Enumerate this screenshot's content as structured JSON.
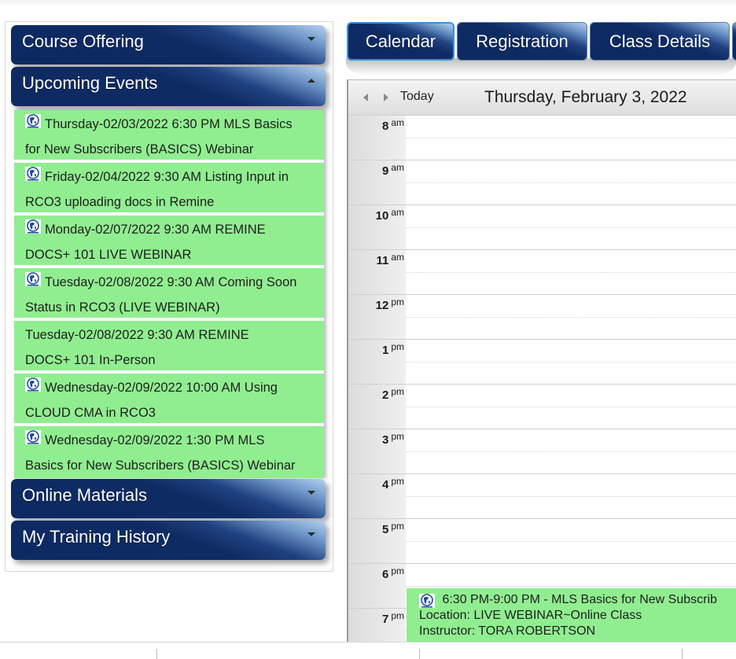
{
  "sidebar": {
    "sections": [
      {
        "label": "Course Offering",
        "state": "collapsed",
        "icon": "chevron-down-icon"
      },
      {
        "label": "Upcoming Events",
        "state": "expanded",
        "icon": "chevron-up-icon"
      },
      {
        "label": "Online Materials",
        "state": "collapsed",
        "icon": "chevron-down-icon"
      },
      {
        "label": "My Training History",
        "state": "collapsed",
        "icon": "chevron-down-icon"
      }
    ],
    "events": [
      {
        "line1": "Thursday-02/03/2022 6:30 PM MLS Basics",
        "line2": "for New Subscribers (BASICS) Webinar",
        "icon": "globe-icon"
      },
      {
        "line1": "Friday-02/04/2022 9:30 AM Listing Input in",
        "line2": "RCO3 uploading docs in Remine",
        "icon": "globe-icon"
      },
      {
        "line1": "Monday-02/07/2022 9:30 AM REMINE",
        "line2": "DOCS+ 101 LIVE WEBINAR",
        "icon": "globe-icon"
      },
      {
        "line1": "Tuesday-02/08/2022 9:30 AM Coming Soon",
        "line2": "Status in RCO3 (LIVE WEBINAR)",
        "icon": "globe-icon"
      },
      {
        "line1": "Tuesday-02/08/2022 9:30 AM REMINE",
        "line2": "DOCS+ 101 In-Person",
        "icon": null
      },
      {
        "line1": "Wednesday-02/09/2022 10:00 AM Using",
        "line2": "CLOUD CMA in RCO3",
        "icon": "globe-icon"
      },
      {
        "line1": "Wednesday-02/09/2022 1:30 PM MLS",
        "line2": "Basics for New Subscribers (BASICS) Webinar",
        "icon": "globe-icon"
      }
    ],
    "event_color": "#90ee90"
  },
  "tabs": [
    {
      "label": "Calendar",
      "active": true
    },
    {
      "label": "Registration",
      "active": false
    },
    {
      "label": "Class Details",
      "active": false
    }
  ],
  "calendar": {
    "today_label": "Today",
    "date_title": "Thursday, February 3, 2022",
    "hours": [
      {
        "num": "8",
        "suffix": "am"
      },
      {
        "num": "9",
        "suffix": "am"
      },
      {
        "num": "10",
        "suffix": "am"
      },
      {
        "num": "11",
        "suffix": "am"
      },
      {
        "num": "12",
        "suffix": "pm"
      },
      {
        "num": "1",
        "suffix": "pm"
      },
      {
        "num": "2",
        "suffix": "pm"
      },
      {
        "num": "3",
        "suffix": "pm"
      },
      {
        "num": "4",
        "suffix": "pm"
      },
      {
        "num": "5",
        "suffix": "pm"
      },
      {
        "num": "6",
        "suffix": "pm"
      },
      {
        "num": "7",
        "suffix": "pm"
      }
    ],
    "event": {
      "time": "6:30 PM-9:00 PM - MLS Basics for New Subscrib",
      "location": "Location: LIVE WEBINAR~Online Class",
      "instructor": "Instructor: TORA ROBERTSON"
    }
  },
  "colors": {
    "header_navy": "#0c2a62",
    "event_green": "#90ee90",
    "active_tab_border": "#3c8fd4"
  }
}
